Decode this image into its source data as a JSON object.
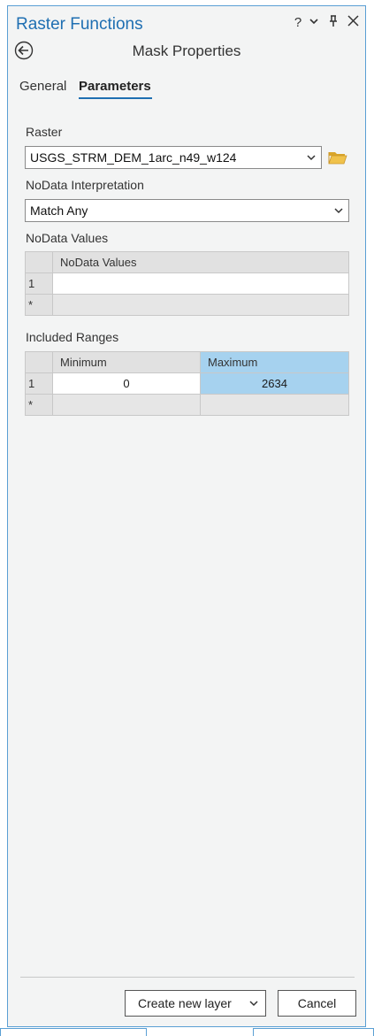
{
  "pane": {
    "title": "Raster Functions",
    "controls": {
      "help": "?",
      "dropdown": "⌄",
      "pin": "📌",
      "close": "✕"
    }
  },
  "page_title": "Mask Properties",
  "tabs": [
    {
      "label": "General",
      "active": false
    },
    {
      "label": "Parameters",
      "active": true
    }
  ],
  "raster": {
    "label": "Raster",
    "value": "USGS_STRM_DEM_1arc_n49_w124"
  },
  "nodata_interpretation": {
    "label": "NoData Interpretation",
    "value": "Match Any"
  },
  "nodata_values": {
    "label": "NoData Values",
    "column": "NoData Values",
    "rows": [
      {
        "index": "1",
        "value": ""
      }
    ],
    "new_row_marker": "*"
  },
  "included_ranges": {
    "label": "Included Ranges",
    "columns": [
      "Minimum",
      "Maximum"
    ],
    "rows": [
      {
        "index": "1",
        "minimum": "0",
        "maximum": "2634"
      }
    ],
    "new_row_marker": "*"
  },
  "footer": {
    "create_label": "Create new layer",
    "cancel_label": "Cancel"
  },
  "colors": {
    "accent": "#1f6fb2",
    "selection": "#a6d2ef",
    "folder": "#e8b93a"
  }
}
